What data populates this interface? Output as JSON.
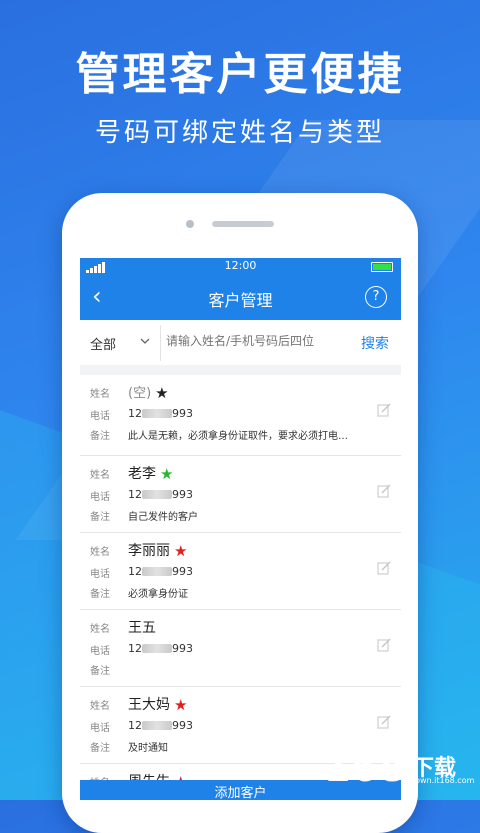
{
  "promo": {
    "headline": "管理客户更便捷",
    "subline": "号码可绑定姓名与类型"
  },
  "statusbar": {
    "time": "12:00"
  },
  "navbar": {
    "back_icon": "‹",
    "title": "客户管理",
    "help_icon": "?"
  },
  "search": {
    "filter_label": "全部",
    "placeholder": "请输入姓名/手机号码后四位",
    "button_label": "搜索"
  },
  "labels": {
    "name": "姓名",
    "phone": "电话",
    "note": "备注"
  },
  "customers": [
    {
      "name": "(空)",
      "star_color": "#222222",
      "phone_prefix": "12",
      "phone_suffix": "993",
      "note": "此人是无赖，必须拿身份证取件，要求必须打电…"
    },
    {
      "name": "老李",
      "star_color": "#2db52d",
      "phone_prefix": "12",
      "phone_suffix": "993",
      "note": "自己发件的客户"
    },
    {
      "name": "李丽丽",
      "star_color": "#e02020",
      "phone_prefix": "12",
      "phone_suffix": "993",
      "note": "必须拿身份证"
    },
    {
      "name": "王五",
      "star_color": "",
      "phone_prefix": "12",
      "phone_suffix": "993",
      "note": ""
    },
    {
      "name": "王大妈",
      "star_color": "#e02020",
      "phone_prefix": "12",
      "phone_suffix": "993",
      "note": "及时通知"
    },
    {
      "name": "周先生",
      "star_color": "#e02020",
      "phone_prefix": "",
      "phone_suffix": "",
      "note": ""
    }
  ],
  "add_button": "添加客户",
  "watermark": {
    "number": "168",
    "text": "下载",
    "url": "down.it168.com"
  },
  "colors": {
    "primary": "#1f82e8",
    "background_top": "#2a6fe0",
    "background_bottom": "#26b0ee"
  }
}
